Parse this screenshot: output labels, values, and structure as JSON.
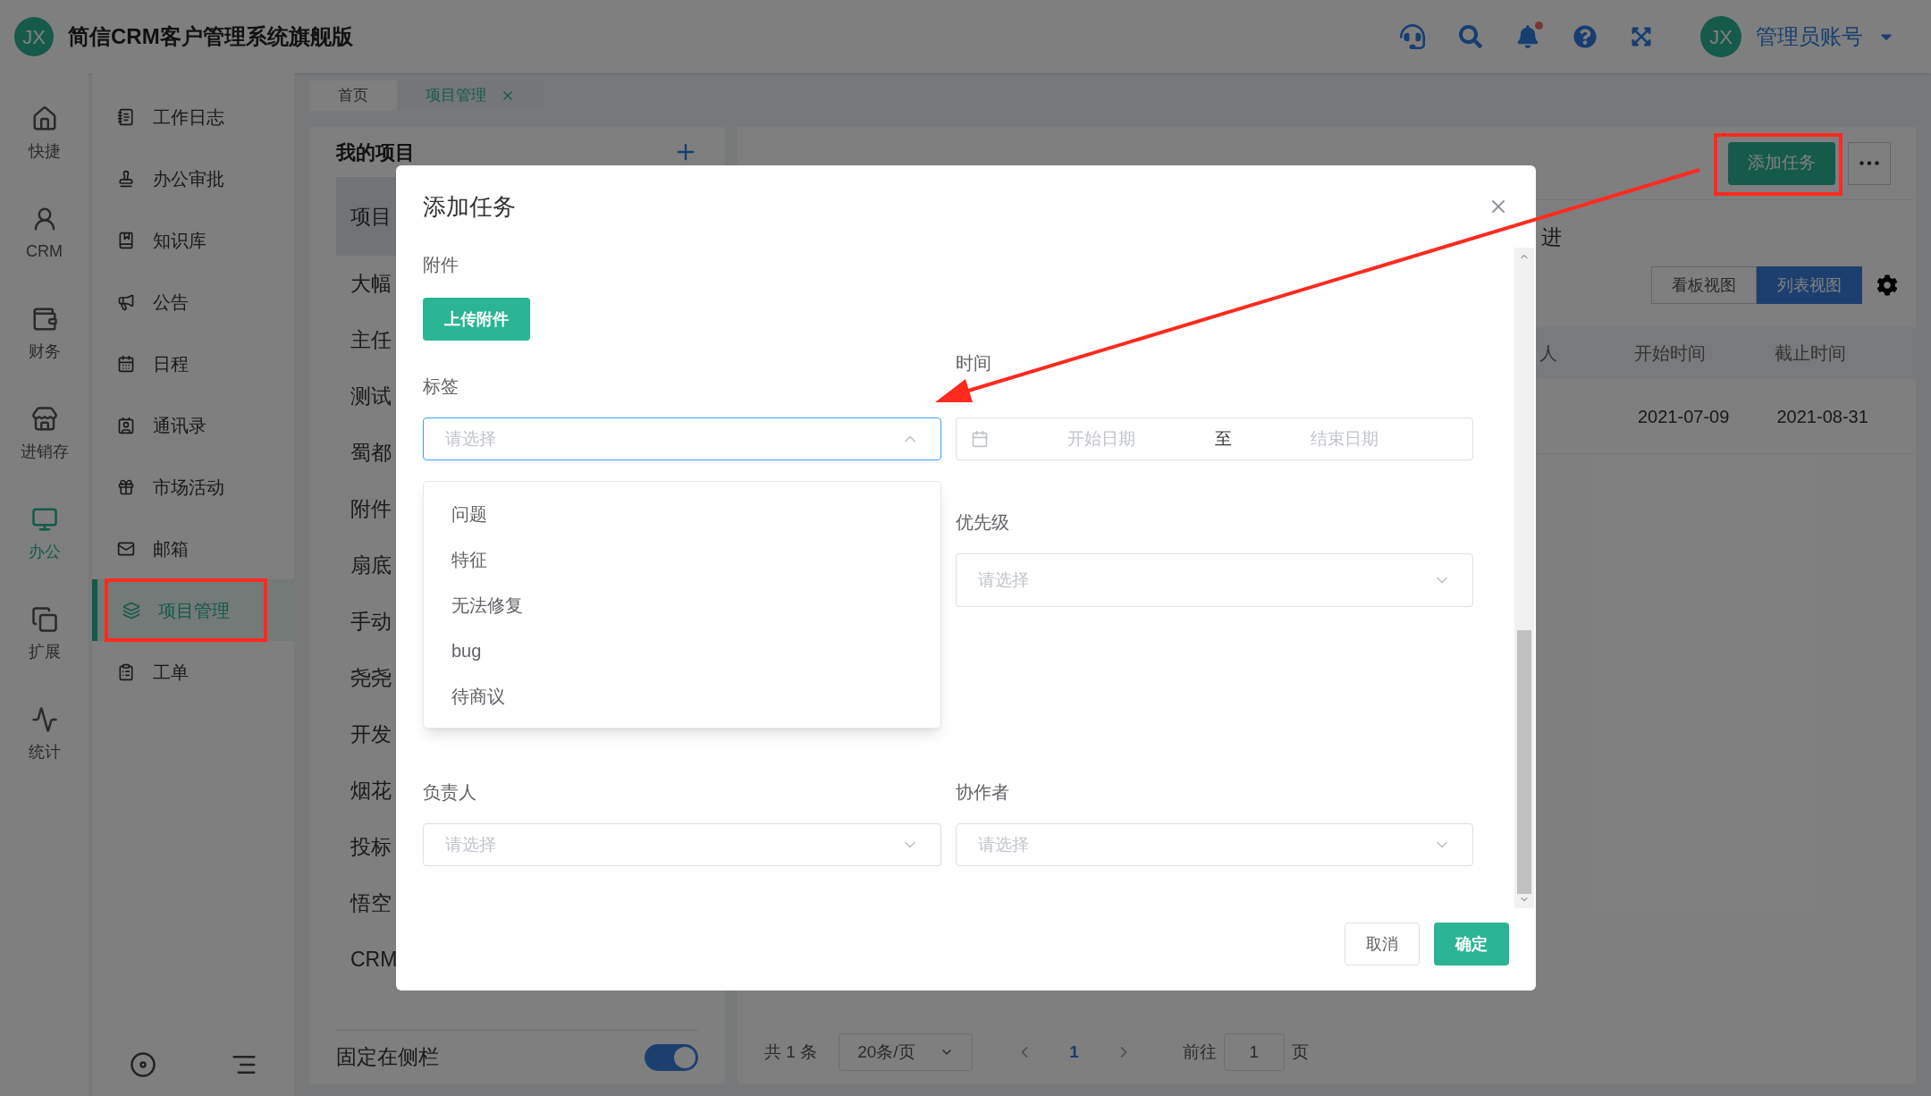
{
  "header": {
    "logo": "JX",
    "title": "简信CRM客户管理系统旗舰版",
    "notification_unread": true,
    "user": {
      "avatar": "JX",
      "name": "管理员账号"
    }
  },
  "rail": [
    {
      "label": "快捷",
      "selected": false
    },
    {
      "label": "CRM",
      "selected": false
    },
    {
      "label": "财务",
      "selected": false
    },
    {
      "label": "进销存",
      "selected": false
    },
    {
      "label": "办公",
      "selected": true
    },
    {
      "label": "扩展",
      "selected": false
    },
    {
      "label": "统计",
      "selected": false
    }
  ],
  "menu": [
    {
      "label": "工作日志",
      "selected": false,
      "annotated": false
    },
    {
      "label": "办公审批",
      "selected": false,
      "annotated": false
    },
    {
      "label": "知识库",
      "selected": false,
      "annotated": false
    },
    {
      "label": "公告",
      "selected": false,
      "annotated": false
    },
    {
      "label": "日程",
      "selected": false,
      "annotated": false
    },
    {
      "label": "通讯录",
      "selected": false,
      "annotated": false
    },
    {
      "label": "市场活动",
      "selected": false,
      "annotated": false
    },
    {
      "label": "邮箱",
      "selected": false,
      "annotated": false
    },
    {
      "label": "项目管理",
      "selected": true,
      "annotated": true
    },
    {
      "label": "工单",
      "selected": false,
      "annotated": false
    }
  ],
  "tabs": [
    {
      "label": "首页",
      "selected": false,
      "closable": false
    },
    {
      "label": "项目管理",
      "selected": true,
      "closable": true
    }
  ],
  "projects": {
    "title": "我的项目",
    "items": [
      {
        "label": "项目",
        "selected": true
      },
      {
        "label": "大幅",
        "selected": false
      },
      {
        "label": "主任",
        "selected": false
      },
      {
        "label": "测试",
        "selected": false
      },
      {
        "label": "蜀都",
        "selected": false
      },
      {
        "label": "附件",
        "selected": false
      },
      {
        "label": "扇底",
        "selected": false
      },
      {
        "label": "手动",
        "selected": false
      },
      {
        "label": "尧尧",
        "selected": false
      },
      {
        "label": "开发",
        "selected": false
      },
      {
        "label": "烟花",
        "selected": false
      },
      {
        "label": "投标",
        "selected": false
      },
      {
        "label": "悟空",
        "selected": false
      },
      {
        "label": "CRM",
        "selected": false
      }
    ],
    "pin": {
      "label": "固定在侧栏",
      "on": true
    }
  },
  "tasks": {
    "add_button": {
      "label": "添加任务",
      "annotated": true
    },
    "status_text": "进",
    "views": [
      {
        "label": "看板视图",
        "selected": false
      },
      {
        "label": "列表视图",
        "selected": true
      }
    ],
    "table": {
      "columns": [
        "人",
        "开始时间",
        "截止时间"
      ],
      "rows": [
        {
          "start": "2021-07-09",
          "end": "2021-08-31"
        }
      ]
    },
    "pagination": {
      "total": "共 1 条",
      "page_size": "20条/页",
      "pages": [
        {
          "label": "1",
          "selected": true
        }
      ],
      "goto_label": "前往",
      "goto_value": "1",
      "goto_suffix": "页"
    }
  },
  "dialog": {
    "title": "添加任务",
    "attachment": {
      "label": "附件",
      "button": "上传附件"
    },
    "tags": {
      "label": "标签",
      "placeholder": "请选择",
      "expanded": true,
      "options": [
        "问题",
        "特征",
        "无法修复",
        "bug",
        "待商议"
      ]
    },
    "time": {
      "label": "时间",
      "start_placeholder": "开始日期",
      "separator": "至",
      "end_placeholder": "结束日期"
    },
    "priority": {
      "label": "优先级",
      "placeholder": "请选择"
    },
    "owner": {
      "label": "负责人",
      "placeholder": "请选择"
    },
    "collaborators": {
      "label": "协作者",
      "placeholder": "请选择"
    },
    "buttons": {
      "cancel": "取消",
      "ok": "确定"
    }
  }
}
